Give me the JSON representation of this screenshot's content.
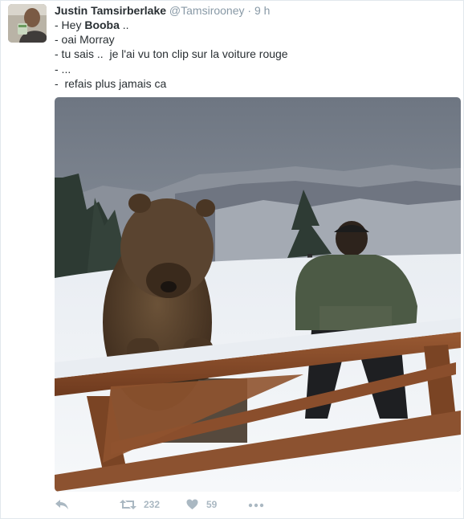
{
  "tweet": {
    "author_name": "Justin Tamsirberlake",
    "handle": "@Tamsirooney",
    "separator": "·",
    "time": "9 h",
    "lines": [
      {
        "prefix": "- Hey ",
        "bold": "Booba",
        "suffix": " .."
      },
      {
        "text": "- oai Morray"
      },
      {
        "text": "- tu sais ..  je l'ai vu ton clip sur la voiture rouge"
      },
      {
        "text": "- ..."
      },
      {
        "text": "-  refais plus jamais ca"
      }
    ]
  },
  "actions": {
    "retweet_count": "232",
    "like_count": "59"
  },
  "icons": {
    "reply": "reply-icon",
    "retweet": "retweet-icon",
    "like": "heart-icon",
    "more": "more-icon"
  },
  "colors": {
    "name": "#292f33",
    "meta": "#8899a6",
    "action": "#aab8c2",
    "border": "#e1e8ed"
  }
}
